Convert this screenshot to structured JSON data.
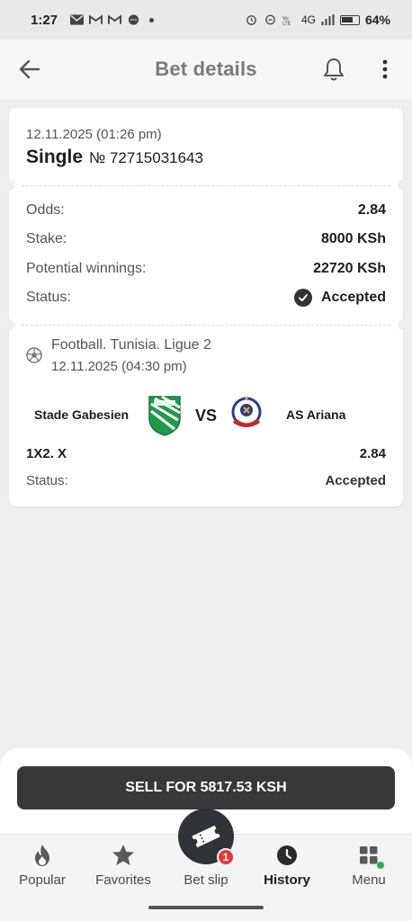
{
  "status_bar": {
    "time": "1:27",
    "network": "4G",
    "battery": "64%"
  },
  "header": {
    "title": "Bet details"
  },
  "bet": {
    "date": "12.11.2025 (01:26 pm)",
    "type": "Single",
    "number": "№ 72715031643",
    "odds_label": "Odds:",
    "odds_value": "2.84",
    "stake_label": "Stake:",
    "stake_value": "8000 KSh",
    "winnings_label": "Potential winnings:",
    "winnings_value": "22720 KSh",
    "status_label": "Status:",
    "status_value": "Accepted"
  },
  "event": {
    "league": "Football. Tunisia. Ligue 2",
    "date": "12.11.2025 (04:30 pm)",
    "home_team": "Stade Gabesien",
    "vs": "vs",
    "away_team": "AS Ariana",
    "outcome": "1X2. X",
    "outcome_odds": "2.84",
    "status_label": "Status:",
    "status_value": "Accepted"
  },
  "sell_button": {
    "label": "SELL FOR 5817.53 KSH"
  },
  "nav": {
    "items": [
      {
        "label": "Popular",
        "icon": "fire-icon"
      },
      {
        "label": "Favorites",
        "icon": "star-icon"
      },
      {
        "label": "Bet slip",
        "icon": "ticket-icon",
        "badge": "1"
      },
      {
        "label": "History",
        "icon": "clock-icon",
        "active": true
      },
      {
        "label": "Menu",
        "icon": "grid-icon"
      }
    ]
  },
  "colors": {
    "accent": "#2f3237",
    "badge": "#e53935",
    "menu_dot": "#2bb24c"
  }
}
